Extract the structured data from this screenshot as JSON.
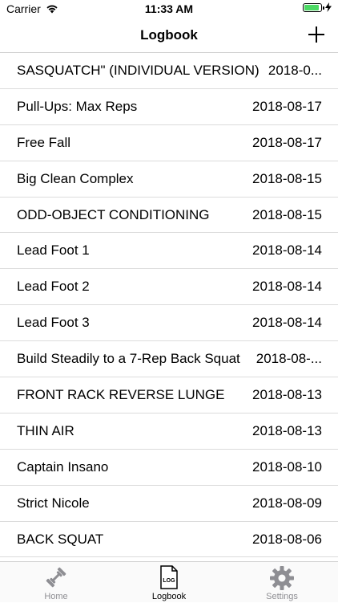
{
  "status": {
    "carrier": "Carrier",
    "time": "11:33 AM"
  },
  "nav": {
    "title": "Logbook",
    "add_icon": "plus-icon"
  },
  "logbook": {
    "entries": [
      {
        "name": "SASQUATCH\" (INDIVIDUAL VERSION)",
        "date": "2018-0..."
      },
      {
        "name": "Pull-Ups: Max Reps",
        "date": "2018-08-17"
      },
      {
        "name": "Free Fall",
        "date": "2018-08-17"
      },
      {
        "name": "Big Clean Complex",
        "date": "2018-08-15"
      },
      {
        "name": "ODD-OBJECT CONDITIONING",
        "date": "2018-08-15"
      },
      {
        "name": "Lead Foot 1",
        "date": "2018-08-14"
      },
      {
        "name": "Lead Foot 2",
        "date": "2018-08-14"
      },
      {
        "name": "Lead Foot 3",
        "date": "2018-08-14"
      },
      {
        "name": "Build Steadily to a 7-Rep Back Squat",
        "date": "2018-08-..."
      },
      {
        "name": "FRONT RACK REVERSE LUNGE",
        "date": "2018-08-13"
      },
      {
        "name": "THIN AIR",
        "date": "2018-08-13"
      },
      {
        "name": "Captain Insano",
        "date": "2018-08-10"
      },
      {
        "name": "Strict Nicole",
        "date": "2018-08-09"
      },
      {
        "name": "BACK SQUAT",
        "date": "2018-08-06"
      }
    ]
  },
  "tabs": [
    {
      "label": "Home",
      "icon": "dumbbell-icon",
      "active": false
    },
    {
      "label": "Logbook",
      "icon": "log-document-icon",
      "icon_text": "LOG",
      "active": true
    },
    {
      "label": "Settings",
      "icon": "gear-icon",
      "active": false
    }
  ],
  "colors": {
    "battery": "#4cd964",
    "inactive_tab": "#8e8e93",
    "separator": "#dcdcdc"
  }
}
